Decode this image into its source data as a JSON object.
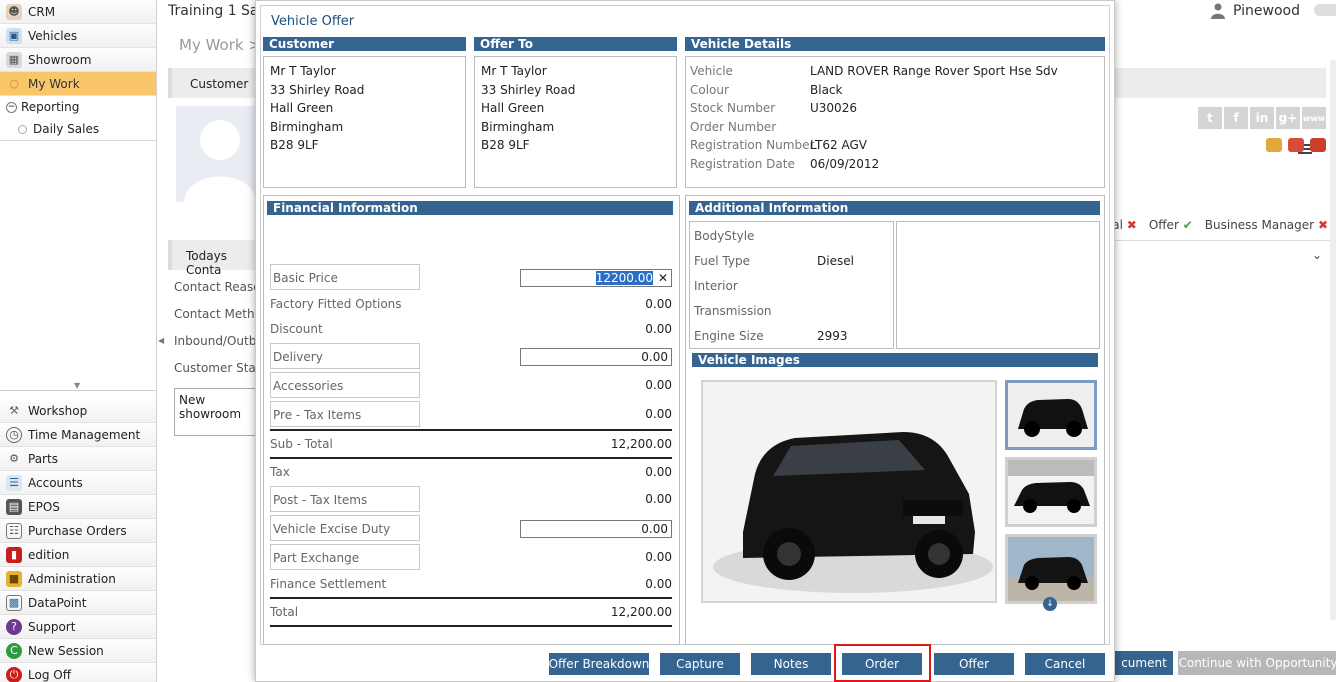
{
  "app": {
    "window_title": "Training 1 Sal",
    "user_name": "Pinewood",
    "breadcrumb": "My Work >"
  },
  "colors": {
    "accent": "#34648f",
    "active_nav": "#f9c76a",
    "highlight_frame": "#e01818",
    "check": "#3aa64a",
    "cross": "#d23b3b"
  },
  "sidebar": {
    "top_items": [
      {
        "label": "CRM",
        "icon": "person-icon"
      },
      {
        "label": "Vehicles",
        "icon": "car-icon"
      },
      {
        "label": "Showroom",
        "icon": "showroom-icon"
      },
      {
        "label": "My Work",
        "icon": "bullet-icon",
        "active": true
      },
      {
        "label": "Reporting",
        "icon": "collapse-icon"
      }
    ],
    "sub_items": [
      {
        "label": "Daily Sales"
      }
    ],
    "bottom_items": [
      {
        "label": "Workshop",
        "icon": "wrench-icon"
      },
      {
        "label": "Time Management",
        "icon": "clock-icon"
      },
      {
        "label": "Parts",
        "icon": "gear-icon"
      },
      {
        "label": "Accounts",
        "icon": "ledger-icon"
      },
      {
        "label": "EPOS",
        "icon": "register-icon"
      },
      {
        "label": "Purchase Orders",
        "icon": "document-icon"
      },
      {
        "label": "edition",
        "icon": "book-icon"
      },
      {
        "label": "Administration",
        "icon": "lock-icon"
      },
      {
        "label": "DataPoint",
        "icon": "datapoint-icon"
      },
      {
        "label": "Support",
        "icon": "support-icon"
      },
      {
        "label": "New Session",
        "icon": "new-session-icon"
      },
      {
        "label": "Log Off",
        "icon": "power-icon"
      }
    ]
  },
  "background": {
    "customer_tab": "Customer",
    "todays_contact": "Todays Conta",
    "fields": [
      "Contact Reason",
      "Contact Method",
      "Inbound/Outbo",
      "Customer Statu"
    ],
    "notes_text": "New showroom",
    "stages": [
      {
        "label": "isal",
        "status": "cross"
      },
      {
        "label": "Offer",
        "status": "check"
      },
      {
        "label": "Business Manager",
        "status": "cross"
      }
    ],
    "social": [
      "twitter",
      "facebook",
      "linkedin",
      "google-plus",
      "www"
    ],
    "social_text": [
      "t",
      "f",
      "in",
      "g+",
      "www"
    ],
    "bottom_buttons": [
      "cument",
      "Continue with Opportunity"
    ]
  },
  "modal": {
    "title": "Vehicle Offer",
    "customer": {
      "heading": "Customer",
      "lines": [
        "Mr T Taylor",
        "33 Shirley Road",
        "Hall Green",
        "Birmingham",
        "B28 9LF"
      ]
    },
    "offer_to": {
      "heading": "Offer To",
      "lines": [
        "Mr T Taylor",
        "33 Shirley Road",
        "Hall Green",
        "Birmingham",
        "B28 9LF"
      ]
    },
    "vehicle_details": {
      "heading": "Vehicle Details",
      "rows": [
        {
          "label": "Vehicle",
          "value": "LAND ROVER Range Rover Sport Hse Sdv"
        },
        {
          "label": "Colour",
          "value": "Black"
        },
        {
          "label": "Stock Number",
          "value": "U30026"
        },
        {
          "label": "Order Number",
          "value": ""
        },
        {
          "label": "Registration Number",
          "value": "LT62 AGV"
        },
        {
          "label": "Registration Date",
          "value": "06/09/2012"
        }
      ]
    },
    "financial": {
      "heading": "Financial Information",
      "basic_price": {
        "label": "Basic Price",
        "value": "12200.00"
      },
      "factory_options": {
        "label": "Factory Fitted Options",
        "value": "0.00"
      },
      "discount": {
        "label": "Discount",
        "value": "0.00"
      },
      "delivery": {
        "label": "Delivery",
        "value": "0.00"
      },
      "accessories": {
        "label": "Accessories",
        "value": "0.00"
      },
      "pre_tax": {
        "label": "Pre - Tax Items",
        "value": "0.00"
      },
      "sub_total": {
        "label": "Sub - Total",
        "value": "12,200.00"
      },
      "tax": {
        "label": "Tax",
        "value": "0.00"
      },
      "post_tax": {
        "label": "Post - Tax Items",
        "value": "0.00"
      },
      "excise": {
        "label": "Vehicle Excise Duty",
        "value": "0.00"
      },
      "part_exchange": {
        "label": "Part Exchange",
        "value": "0.00"
      },
      "finance_settlement": {
        "label": "Finance Settlement",
        "value": "0.00"
      },
      "total": {
        "label": "Total",
        "value": "12,200.00"
      },
      "clear_glyph": "✕"
    },
    "additional": {
      "heading": "Additional Information",
      "rows": [
        {
          "label": "BodyStyle",
          "value": ""
        },
        {
          "label": "Fuel Type",
          "value": "Diesel"
        },
        {
          "label": "Interior",
          "value": ""
        },
        {
          "label": "Transmission",
          "value": ""
        },
        {
          "label": "Engine Size",
          "value": "2993"
        }
      ]
    },
    "images": {
      "heading": "Vehicle Images",
      "thumbnail_count": 3
    },
    "buttons": {
      "offer_breakdown": "Offer Breakdown",
      "capture": "Capture",
      "notes": "Notes",
      "order": "Order",
      "offer": "Offer",
      "cancel": "Cancel"
    }
  }
}
